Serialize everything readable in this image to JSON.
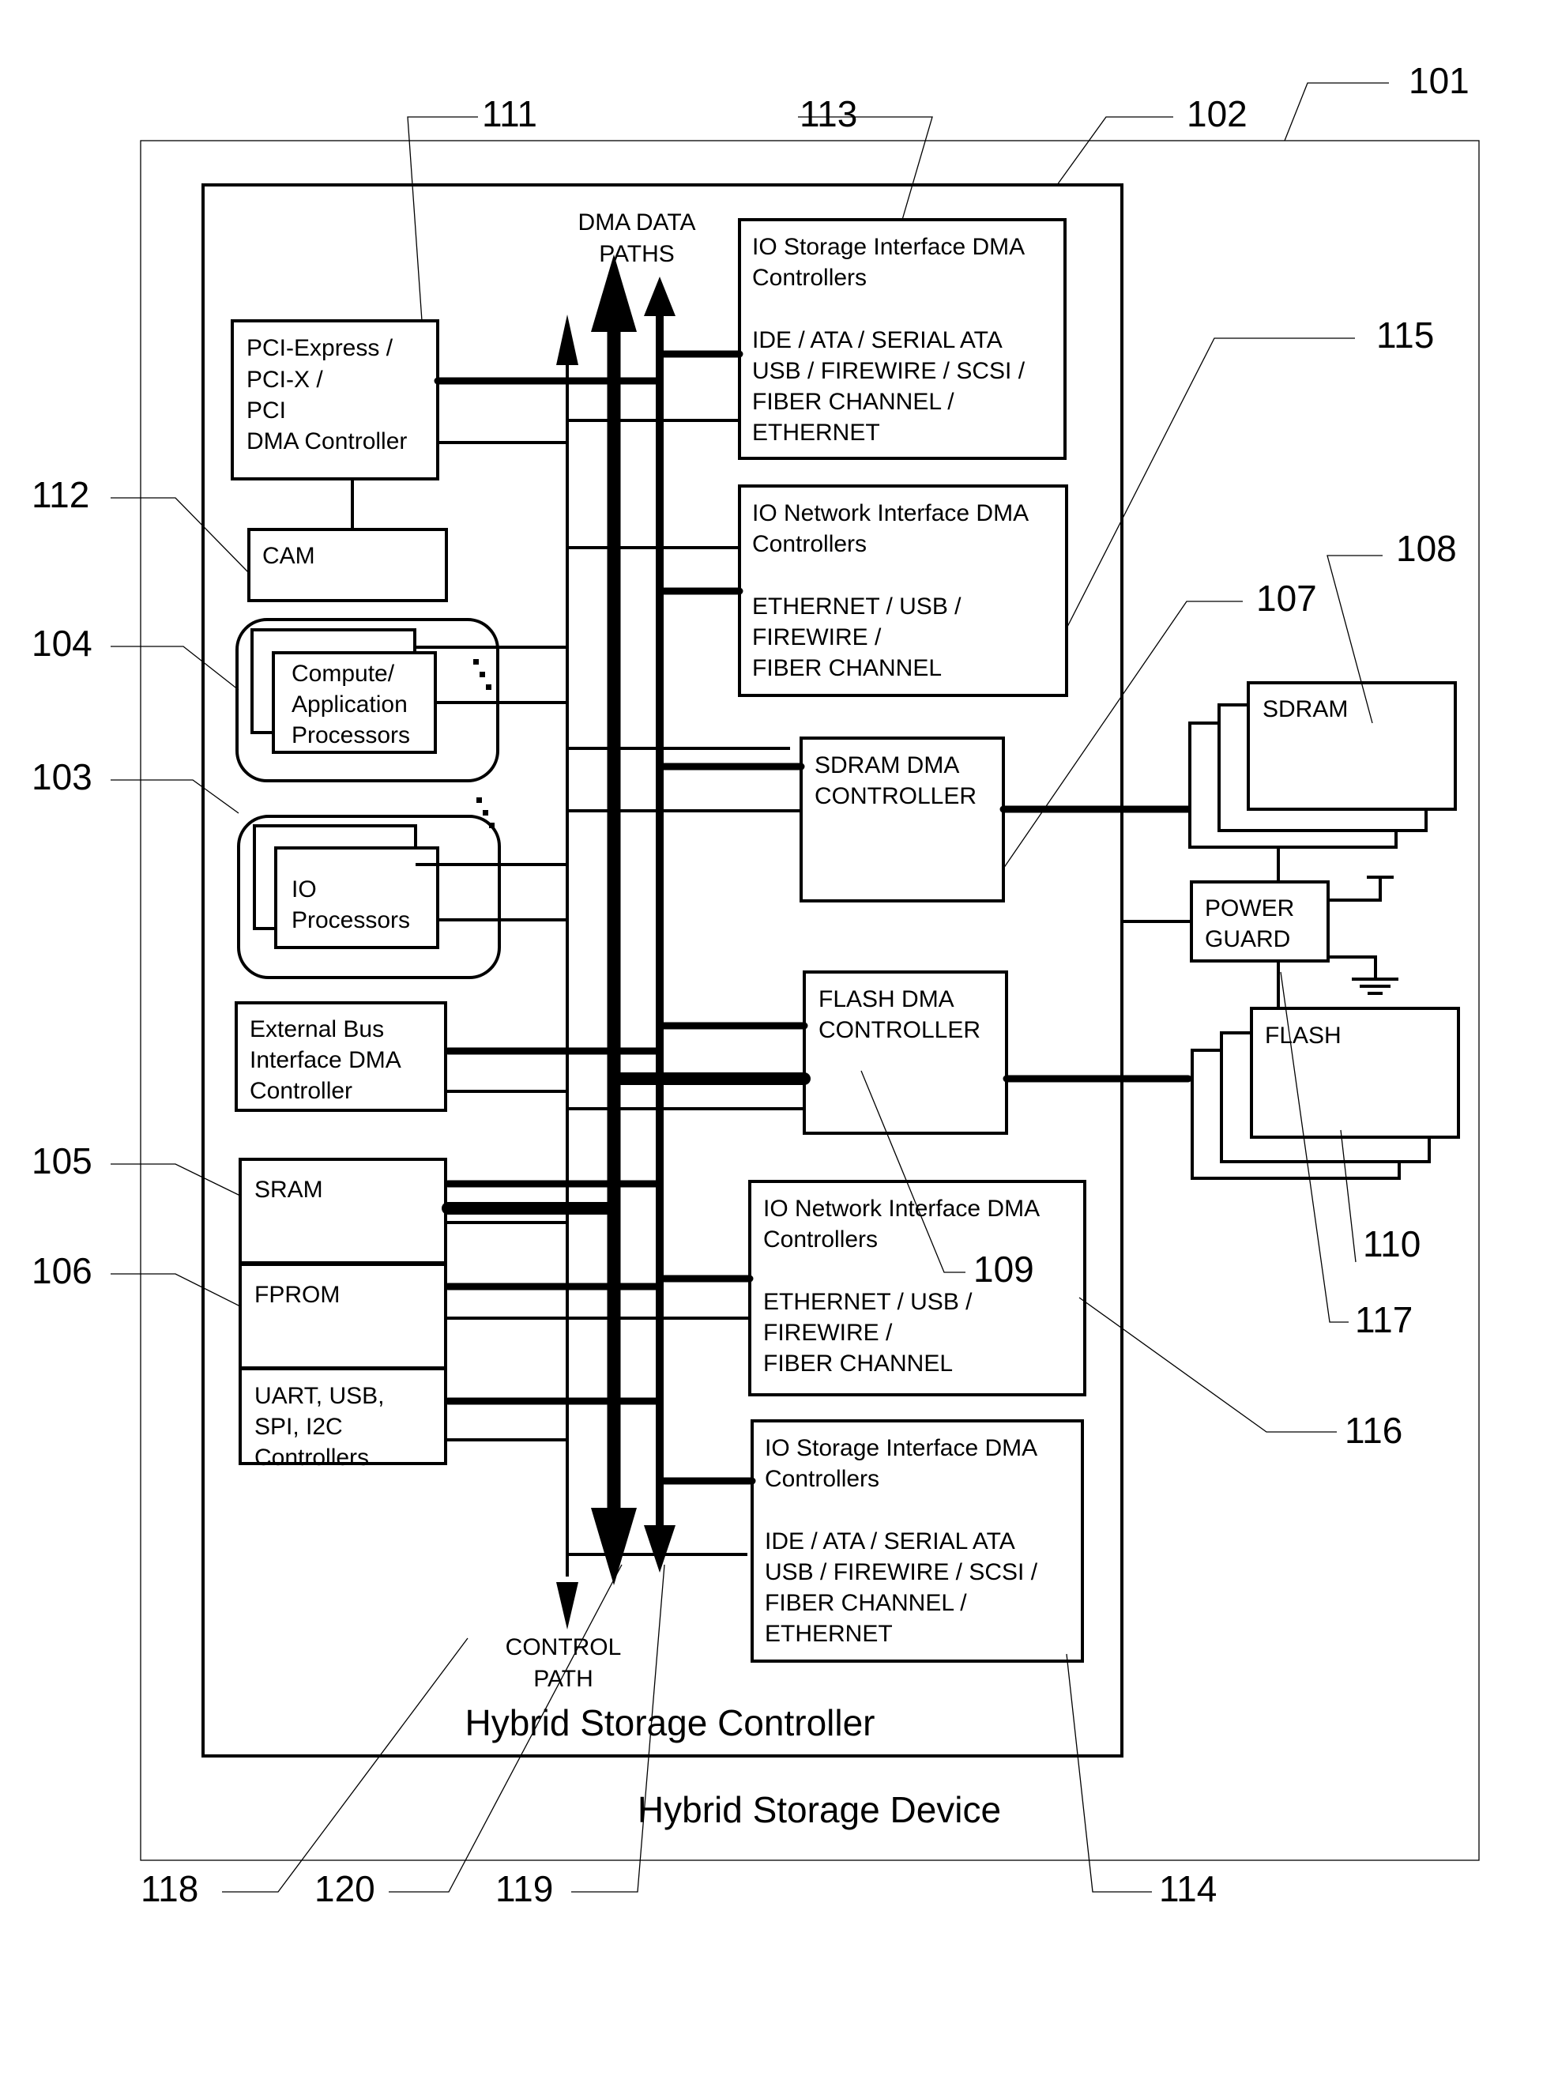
{
  "figure": {
    "device_title": "Hybrid Storage Device",
    "controller_title": "Hybrid Storage Controller",
    "bus_labels": {
      "dma_data_paths": [
        "DMA DATA",
        "PATHS"
      ],
      "control_path": [
        "CONTROL",
        "PATH"
      ]
    }
  },
  "blocks": {
    "pci": [
      "PCI-Express /",
      "PCI-X /",
      "PCI",
      "DMA Controller"
    ],
    "cam": [
      "CAM"
    ],
    "compute": [
      "Compute/",
      "Application",
      "Processors"
    ],
    "io_proc": [
      "IO",
      "Processors"
    ],
    "ext_bus": [
      "External Bus",
      "Interface DMA",
      "Controller"
    ],
    "sram": [
      "SRAM"
    ],
    "fprom": [
      "FPROM"
    ],
    "uart": [
      "UART, USB,",
      "SPI, I2C",
      "Controllers"
    ],
    "io_storage_top": [
      "IO Storage Interface DMA",
      "Controllers",
      "",
      "IDE / ATA / SERIAL ATA",
      "USB / FIREWIRE / SCSI /",
      "FIBER CHANNEL /",
      "ETHERNET"
    ],
    "io_network_top": [
      "IO Network Interface DMA",
      "Controllers",
      "",
      "ETHERNET / USB /",
      "FIREWIRE /",
      "FIBER CHANNEL"
    ],
    "sdram_dma": [
      "SDRAM DMA",
      "CONTROLLER"
    ],
    "flash_dma": [
      "FLASH DMA",
      "CONTROLLER"
    ],
    "io_network_bottom": [
      "IO Network Interface DMA",
      "Controllers",
      "",
      "ETHERNET / USB /",
      "FIREWIRE /",
      "FIBER CHANNEL"
    ],
    "io_storage_bottom": [
      "IO Storage Interface DMA",
      "Controllers",
      "",
      "IDE / ATA / SERIAL ATA",
      "USB / FIREWIRE / SCSI /",
      "FIBER CHANNEL /",
      "ETHERNET"
    ],
    "sdram": [
      "SDRAM"
    ],
    "power_guard": [
      "POWER",
      "GUARD"
    ],
    "flash": [
      "FLASH"
    ]
  },
  "reference_numerals": {
    "r101": "101",
    "r102": "102",
    "r103": "103",
    "r104": "104",
    "r105": "105",
    "r106": "106",
    "r107": "107",
    "r108": "108",
    "r109": "109",
    "r110": "110",
    "r111": "111",
    "r112": "112",
    "r113": "113",
    "r114": "114",
    "r115": "115",
    "r116": "116",
    "r117": "117",
    "r118": "118",
    "r119": "119",
    "r120": "120"
  }
}
